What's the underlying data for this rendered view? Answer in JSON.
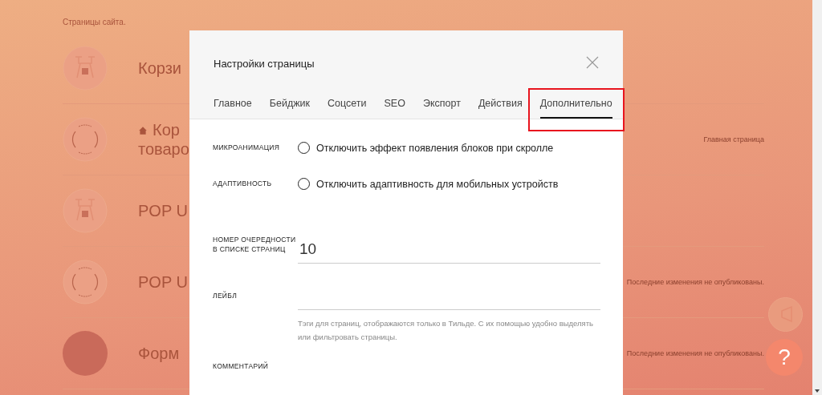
{
  "site_pages": {
    "heading": "Страницы сайта.",
    "pages": [
      {
        "title": "Корзи",
        "home": false,
        "kind": "drone"
      },
      {
        "title": "Кор",
        "title_line2": "товаро",
        "home": true,
        "kind": "logo",
        "status": "Главная страница"
      },
      {
        "title": "POP U",
        "home": false,
        "kind": "drone"
      },
      {
        "title": "POP U",
        "home": false,
        "kind": "logo",
        "status": "Последние изменения не опубликованы."
      },
      {
        "title": "Форм",
        "home": false,
        "kind": "photo",
        "status": "Последние изменения не опубликованы."
      }
    ]
  },
  "dialog": {
    "title": "Настройки страницы",
    "tabs": [
      {
        "label": "Главное",
        "selected": false,
        "highlighted": false
      },
      {
        "label": "Бейджик",
        "selected": false,
        "highlighted": false
      },
      {
        "label": "Соцсети",
        "selected": false,
        "highlighted": false
      },
      {
        "label": "SEO",
        "selected": false,
        "highlighted": false
      },
      {
        "label": "Экспорт",
        "selected": false,
        "highlighted": false
      },
      {
        "label": "Действия",
        "selected": false,
        "highlighted": false
      },
      {
        "label": "Дополнительно",
        "selected": true,
        "highlighted": true
      }
    ],
    "settings": [
      {
        "kind": "radio",
        "label": "МИКРОАНИМАЦИЯ",
        "option": "Отключить эффект появления блоков при скролле",
        "checked": false
      },
      {
        "kind": "radio",
        "label": "АДАПТИВНОСТЬ",
        "option": "Отключить адаптивность для мобильных устройств",
        "checked": false
      },
      {
        "kind": "input",
        "label": "НОМЕР ОЧЕРЕДНОСТИ В СПИСКЕ СТРАНИЦ",
        "value": "10"
      },
      {
        "kind": "input",
        "label": "ЛЕЙБЛ",
        "hint": "Тэги для страниц, отображаются только в Тильде. С их помощью удобно выделять или фильтровать страницы."
      },
      {
        "kind": "heading",
        "label": "КОММЕНТАРИЙ"
      }
    ]
  },
  "help_button": {
    "label": "?"
  }
}
